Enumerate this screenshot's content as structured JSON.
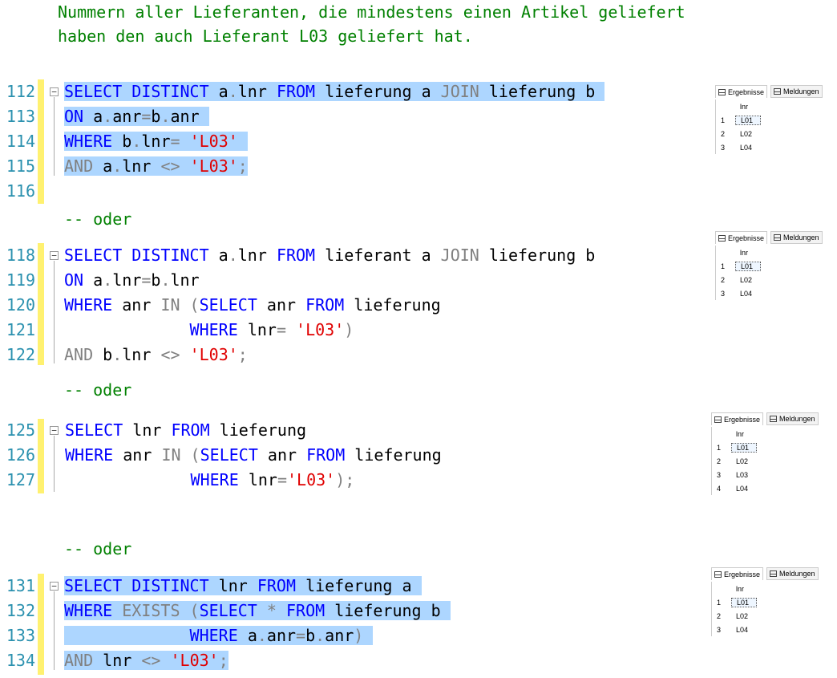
{
  "header_comment": {
    "line1": "Nummern aller Lieferanten, die mindestens einen Artikel geliefert",
    "line2": "haben den auch Lieferant L03 geliefert hat."
  },
  "comments": {
    "oder1": "-- oder",
    "oder2": "-- oder",
    "oder3": "-- oder"
  },
  "line_numbers": {
    "b1": [
      "112",
      "113",
      "114",
      "115",
      "116"
    ],
    "b2": [
      "118",
      "119",
      "120",
      "121",
      "122"
    ],
    "b3": [
      "125",
      "126",
      "127"
    ],
    "b4": [
      "131",
      "132",
      "133",
      "134"
    ]
  },
  "results_panel": {
    "tab_results": "Ergebnisse",
    "tab_messages": "Meldungen",
    "column": "lnr"
  },
  "results": {
    "r1": [
      [
        "1",
        "L01"
      ],
      [
        "2",
        "L02"
      ],
      [
        "3",
        "L04"
      ]
    ],
    "r2": [
      [
        "1",
        "L01"
      ],
      [
        "2",
        "L02"
      ],
      [
        "3",
        "L04"
      ]
    ],
    "r3": [
      [
        "1",
        "L01"
      ],
      [
        "2",
        "L02"
      ],
      [
        "3",
        "L03"
      ],
      [
        "4",
        "L04"
      ]
    ],
    "r4": [
      [
        "1",
        "L01"
      ],
      [
        "2",
        "L02"
      ],
      [
        "3",
        "L04"
      ]
    ]
  },
  "colors": {
    "keyword": "#0000ff",
    "string": "#e00000",
    "operator": "#808080",
    "comment": "#008000",
    "line_number": "#2b91af",
    "selection": "#add6ff",
    "change_marker": "#fff170"
  }
}
